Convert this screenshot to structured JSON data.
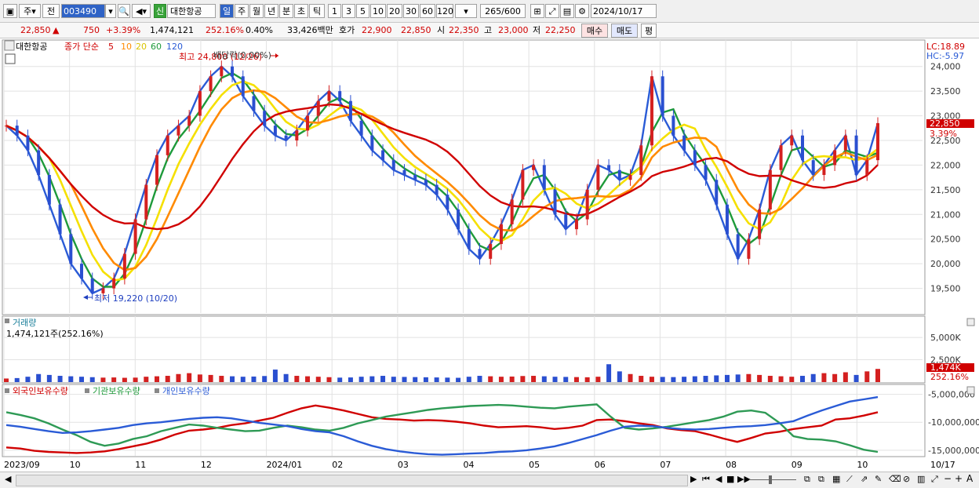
{
  "toolbar": {
    "period_type": "주",
    "prev_label": "전",
    "code": "003490",
    "new_badge": "신",
    "name": "대한항공",
    "period_tabs": [
      "일",
      "주",
      "월",
      "년",
      "분",
      "초",
      "틱"
    ],
    "interval_buttons": [
      "1",
      "3",
      "5",
      "10",
      "20",
      "30",
      "60",
      "120"
    ],
    "count": "265",
    "count_total": "/600",
    "date": "2024/10/17"
  },
  "quote": {
    "price": "22,850",
    "change": "750",
    "change_pct": "+3.39%",
    "volume": "1,474,121",
    "volume_ratio": "252.16%",
    "turnover": "0.40%",
    "amount": "33,426백만",
    "ask_label": "호가",
    "ask": "22,900",
    "bid": "22,850",
    "open_label": "시",
    "open": "22,350",
    "high_label": "고",
    "high": "23,000",
    "low_label": "저",
    "low": "22,250",
    "buy_btn": "매수",
    "sell_btn": "매도",
    "eval_btn": "평"
  },
  "price_panel": {
    "title": "대한항공",
    "legend_prefix": "종가 단순",
    "ma_labels": [
      "5",
      "10",
      "20",
      "60",
      "120"
    ],
    "ma_colors": [
      "#d00000",
      "#ff8a00",
      "#f5e000",
      "#1e9a3a",
      "#2a5bd6"
    ],
    "lc": "LC:18.89",
    "hc": "HC:-5.97",
    "high_annotation": "최고 24,800 (12/26)",
    "overlap_annotation": "배당락(0.00%)",
    "low_annotation": "최저 19,220 (10/20)",
    "current_tag": "22,850",
    "current_pct": "3.39%",
    "y_ticks": [
      "24,000",
      "23,500",
      "23,000",
      "22,500",
      "22,000",
      "21,500",
      "21,000",
      "20,500",
      "20,000",
      "19,500"
    ]
  },
  "volume_panel": {
    "title": "거래량",
    "value": "1,474,121주(252.16%)",
    "y_ticks": [
      "5,000K",
      "2,500K"
    ],
    "tag": "1,474K",
    "tag_pct": "252.16%"
  },
  "holdings_panel": {
    "series": [
      "외국인보유수량",
      "기관보유수량",
      "개인보유수량"
    ],
    "y_ticks": [
      "-5,000,000",
      "-10,000,000",
      "-15,000,000"
    ]
  },
  "xaxis": [
    "2023/09",
    "10",
    "11",
    "12",
    "2024/01",
    "02",
    "03",
    "04",
    "05",
    "06",
    "07",
    "08",
    "09",
    "10",
    "10/17"
  ],
  "chart_data": {
    "type": "line",
    "title": "대한항공",
    "ylim": [
      19220,
      24800
    ],
    "price_close": [
      22800,
      22600,
      22300,
      21800,
      21200,
      20600,
      20000,
      19700,
      19400,
      19500,
      19700,
      20200,
      20900,
      21600,
      22200,
      22600,
      22800,
      23000,
      23500,
      23800,
      24000,
      23800,
      23400,
      23100,
      22800,
      22600,
      22500,
      22700,
      23000,
      23300,
      23500,
      23300,
      22900,
      22600,
      22300,
      22100,
      21900,
      21800,
      21700,
      21600,
      21400,
      21100,
      20700,
      20300,
      20100,
      20400,
      20800,
      21300,
      21900,
      22000,
      21500,
      21000,
      20700,
      20900,
      21500,
      22000,
      21900,
      21700,
      21800,
      22400,
      23800,
      23000,
      22600,
      22300,
      22000,
      21700,
      21200,
      20600,
      20100,
      20500,
      21100,
      21900,
      22400,
      22600,
      22100,
      21800,
      22000,
      22300,
      22600,
      21800,
      22100,
      22850
    ],
    "volume_k": [
      400,
      450,
      600,
      900,
      800,
      700,
      650,
      600,
      550,
      500,
      520,
      480,
      500,
      600,
      650,
      700,
      900,
      1000,
      850,
      800,
      700,
      650,
      600,
      620,
      680,
      1400,
      900,
      700,
      650,
      600,
      550,
      500,
      520,
      600,
      650,
      700,
      600,
      580,
      560,
      540,
      520,
      500,
      480,
      600,
      700,
      650,
      600,
      620,
      680,
      700,
      650,
      600,
      580,
      560,
      540,
      600,
      2000,
      1200,
      900,
      700,
      600,
      580,
      560,
      600,
      650,
      700,
      750,
      800,
      850,
      900,
      800,
      700,
      650,
      600,
      700,
      900,
      1000,
      900,
      1100,
      800,
      1200,
      1474
    ],
    "foreign_holding": [
      -14500000,
      -14700000,
      -15100000,
      -15300000,
      -15400000,
      -15500000,
      -15400000,
      -15200000,
      -14800000,
      -14300000,
      -13800000,
      -13100000,
      -12200000,
      -11500000,
      -11300000,
      -11000000,
      -10500000,
      -10200000,
      -9700000,
      -9200000,
      -8300000,
      -7500000,
      -7000000,
      -7400000,
      -7900000,
      -8500000,
      -9100000,
      -9400000,
      -9500000,
      -9700000,
      -9600000,
      -9700000,
      -9900000,
      -10200000,
      -10600000,
      -10900000,
      -10800000,
      -10700000,
      -10900000,
      -11200000,
      -11000000,
      -10600000,
      -9600000,
      -9500000,
      -9800000,
      -10200000,
      -10500000,
      -11100000,
      -11400000,
      -11600000,
      -12200000,
      -12900000,
      -13500000,
      -12800000,
      -12000000,
      -11700000,
      -11200000,
      -10900000,
      -10600000,
      -9500000,
      -9300000,
      -8800000,
      -8200000
    ],
    "inst_holding": [
      -8200000,
      -8700000,
      -9300000,
      -10200000,
      -11300000,
      -12300000,
      -13500000,
      -14200000,
      -13800000,
      -13000000,
      -12500000,
      -11600000,
      -11000000,
      -10400000,
      -10600000,
      -11000000,
      -11300000,
      -11600000,
      -11500000,
      -11000000,
      -10600000,
      -10900000,
      -11300000,
      -11500000,
      -11000000,
      -10200000,
      -9600000,
      -9000000,
      -8600000,
      -8200000,
      -7800000,
      -7500000,
      -7300000,
      -7100000,
      -7000000,
      -6900000,
      -7000000,
      -7200000,
      -7400000,
      -7500000,
      -7200000,
      -7000000,
      -6800000,
      -9000000,
      -11000000,
      -11300000,
      -11100000,
      -10800000,
      -10400000,
      -10000000,
      -9600000,
      -9000000,
      -8100000,
      -7900000,
      -8300000,
      -10100000,
      -12500000,
      -13000000,
      -13100000,
      -13400000,
      -14100000,
      -14900000,
      -15300000
    ],
    "indiv_holding": [
      -10500000,
      -10800000,
      -11200000,
      -11600000,
      -11900000,
      -11800000,
      -11600000,
      -11300000,
      -11000000,
      -10500000,
      -10200000,
      -10000000,
      -9700000,
      -9400000,
      -9200000,
      -9100000,
      -9300000,
      -9700000,
      -10100000,
      -10400000,
      -10700000,
      -11200000,
      -11600000,
      -11800000,
      -12500000,
      -13400000,
      -14200000,
      -14800000,
      -15200000,
      -15500000,
      -15700000,
      -15800000,
      -15700000,
      -15600000,
      -15500000,
      -15300000,
      -15200000,
      -15000000,
      -14700000,
      -14300000,
      -13700000,
      -13000000,
      -12300000,
      -11500000,
      -10800000,
      -10600000,
      -10700000,
      -11000000,
      -11200000,
      -11300000,
      -11200000,
      -11000000,
      -10800000,
      -10700000,
      -10500000,
      -10200000,
      -9800000,
      -8800000,
      -7900000,
      -7100000,
      -6300000,
      -5900000,
      -5500000
    ]
  },
  "bottom": {
    "nav_icons": [
      "▶",
      "⏮",
      "◀",
      "■",
      "▶▶"
    ]
  }
}
